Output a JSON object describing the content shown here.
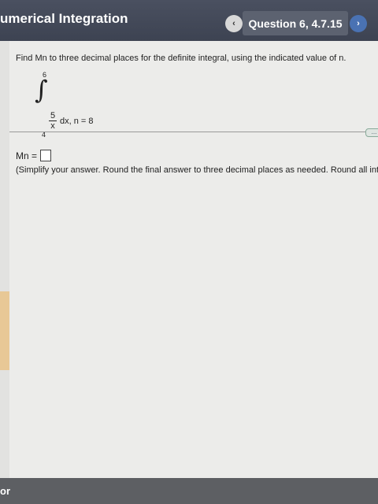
{
  "header": {
    "title": "umerical Integration",
    "question": "Question 6, 4.7.15",
    "prev_icon": "‹",
    "next_icon": "›"
  },
  "problem": {
    "prompt": "Find Mn to three decimal places for the definite integral, using the indicated value of n.",
    "upper_limit": "6",
    "lower_limit": "4",
    "numerator": "5",
    "denominator": "x",
    "differential": "dx, n = 8"
  },
  "answer": {
    "label": "Mn =",
    "value": "",
    "hint": "(Simplify your answer. Round the final answer to three decimal places as needed. Round all interm"
  },
  "more_button": "...",
  "footer": {
    "label": "or"
  },
  "colors": {
    "header_bg": "#414757",
    "next_button": "#4a72b3",
    "content_bg": "#ececea"
  }
}
